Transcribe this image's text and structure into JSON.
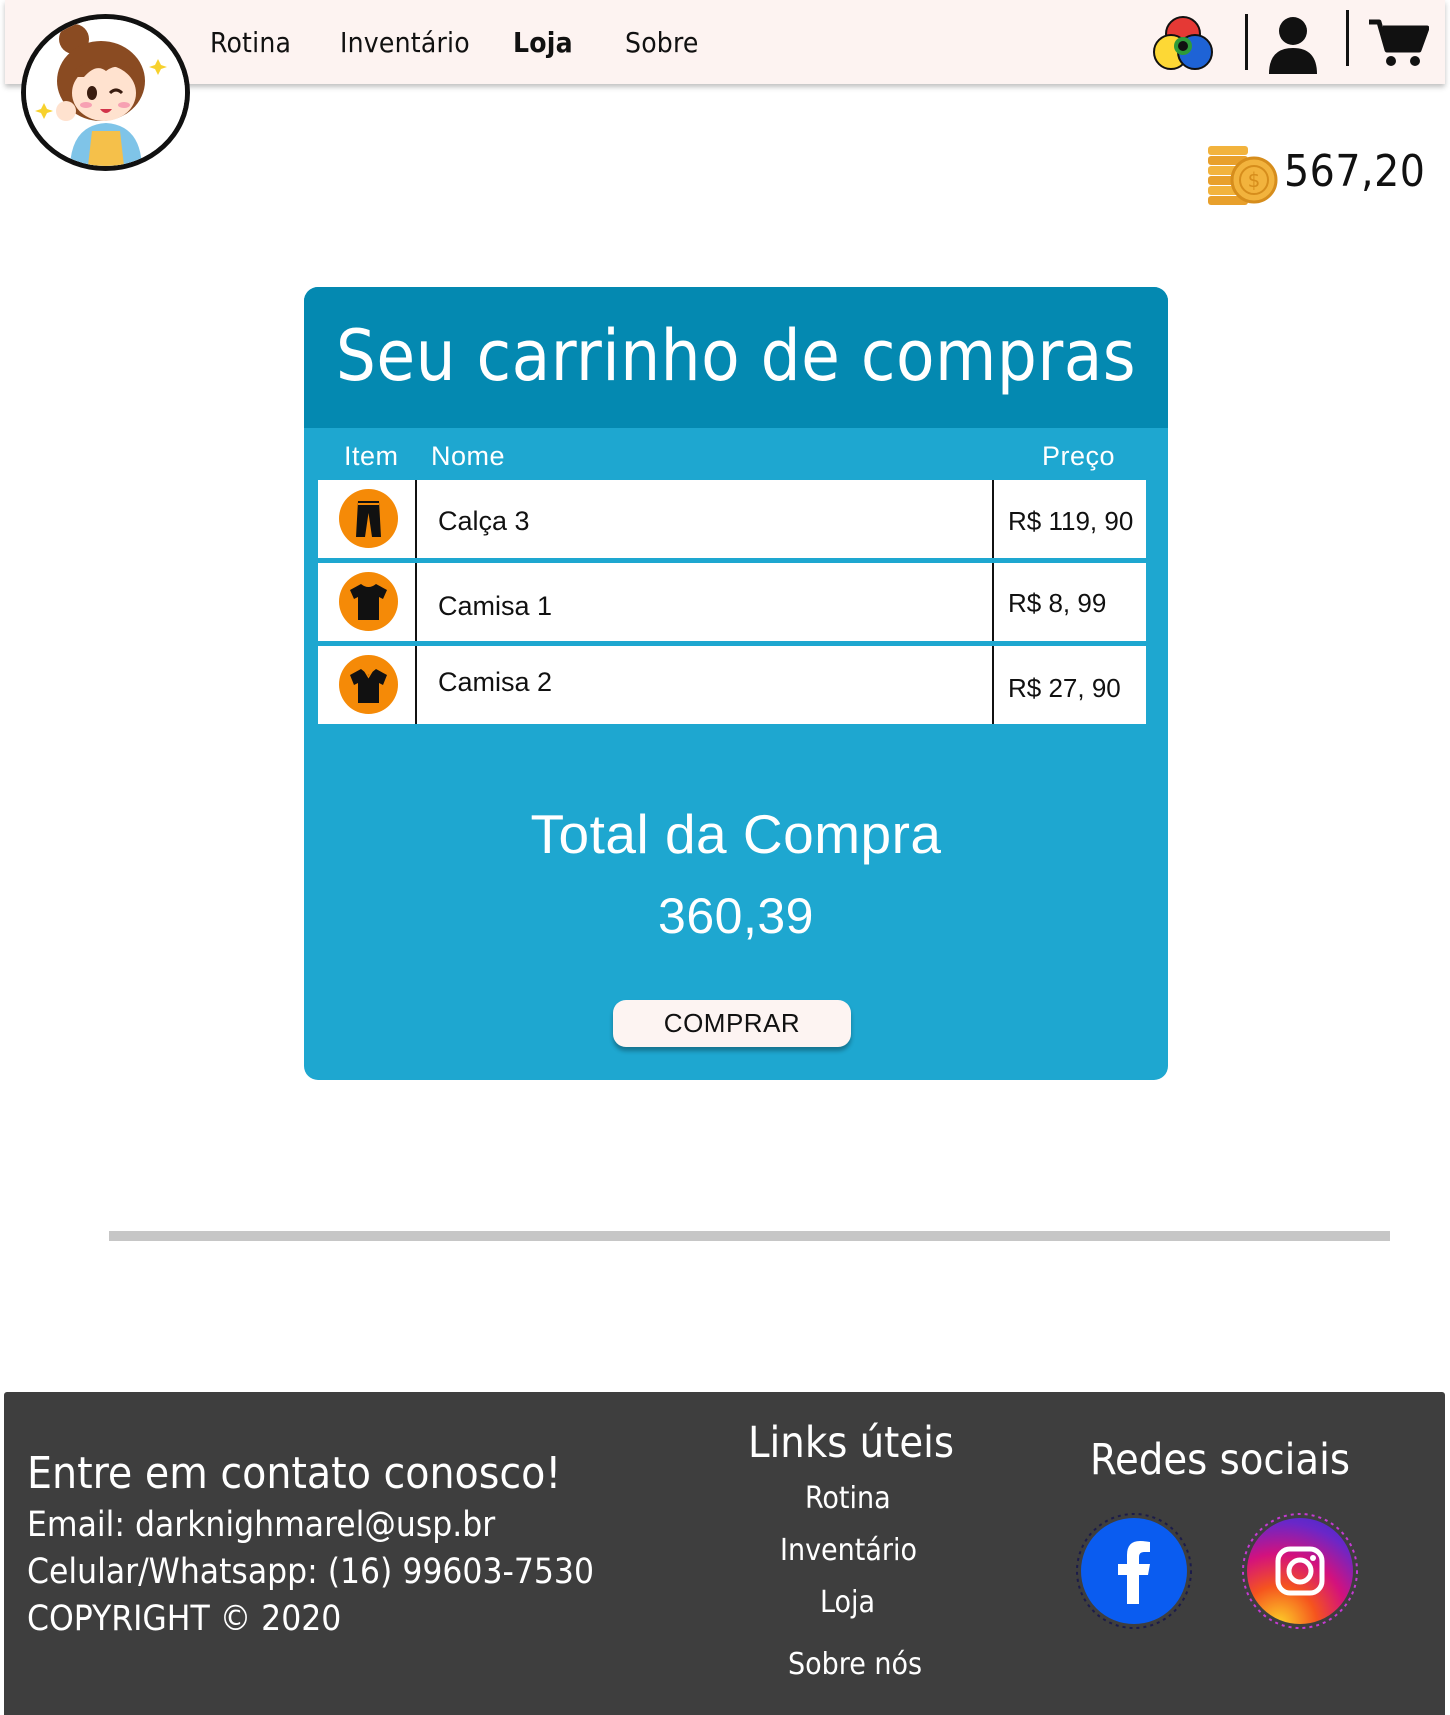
{
  "nav": {
    "items": [
      {
        "label": "Rotina",
        "active": false
      },
      {
        "label": "Inventário",
        "active": false
      },
      {
        "label": "Loja",
        "active": true
      },
      {
        "label": "Sobre",
        "active": false
      }
    ],
    "icons": [
      "color-palette-icon",
      "user-icon",
      "cart-icon"
    ]
  },
  "wallet": {
    "icon": "coins-icon",
    "balance": "567,20"
  },
  "cart": {
    "title": "Seu carrinho de compras",
    "columns": {
      "item": "Item",
      "name": "Nome",
      "price": "Preço"
    },
    "rows": [
      {
        "icon": "pants-icon",
        "name": "Calça 3",
        "price": "R$ 119, 90"
      },
      {
        "icon": "tshirt-icon",
        "name": "Camisa 1",
        "price": "R$ 8, 99"
      },
      {
        "icon": "polo-shirt-icon",
        "name": "Camisa 2",
        "price": "R$ 27, 90"
      }
    ],
    "total_label": "Total da Compra",
    "total_value": "360,39",
    "buy_label": "COMPRAR"
  },
  "footer": {
    "contact": {
      "title": "Entre em contato conosco!",
      "email": "Email: darknighmarel@usp.br",
      "phone": "Celular/Whatsapp: (16) 99603-7530",
      "copyright": "COPYRIGHT © 2020"
    },
    "links": {
      "title": "Links úteis",
      "items": [
        "Rotina",
        "Inventário",
        "Loja",
        "Sobre nós"
      ]
    },
    "social": {
      "title": "Redes sociais",
      "items": [
        "facebook-icon",
        "instagram-icon"
      ]
    }
  },
  "colors": {
    "header_bg": "#fdf3f1",
    "cart_header": "#0489b1",
    "cart_body": "#1ea7d0",
    "item_badge": "#f58a07",
    "footer_bg": "#3e3e3e",
    "divider": "#c6c6c6"
  }
}
